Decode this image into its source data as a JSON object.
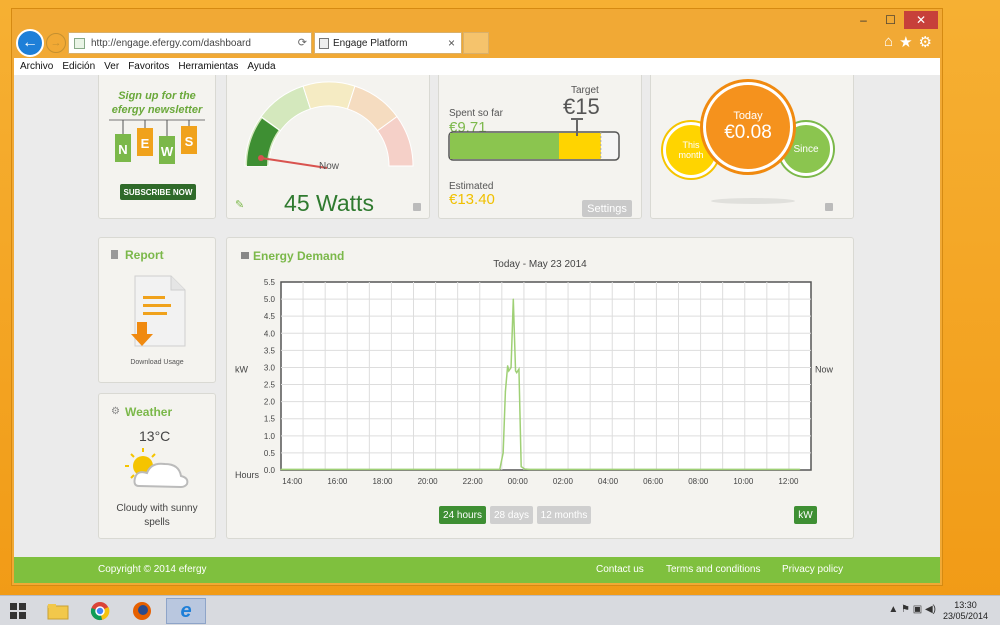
{
  "browser": {
    "url": "http://engage.efergy.com/dashboard",
    "url_host": "engage.efergy.com",
    "tab_title": "Engage Platform",
    "menu": [
      "Archivo",
      "Edición",
      "Ver",
      "Favoritos",
      "Herramientas",
      "Ayuda"
    ],
    "window_controls": {
      "minimize": "–",
      "maximize": "☐",
      "close": "✕"
    }
  },
  "newsletter": {
    "line1": "Sign up for the",
    "line2": "efergy newsletter",
    "tags": [
      "N",
      "E",
      "W",
      "S"
    ],
    "button": "SUBSCRIBE NOW"
  },
  "gauge": {
    "label": "Now",
    "value": "45 Watts",
    "level": 0.07
  },
  "budget": {
    "spent_label": "Spent so far",
    "spent_value": "€9.71",
    "target_label": "Target",
    "target_value": "€15",
    "estimated_label": "Estimated",
    "estimated_value": "€13.40",
    "settings": "Settings",
    "spent_fraction": 0.647,
    "estimated_fraction": 0.893
  },
  "costs": {
    "this_month": [
      "This",
      "month"
    ],
    "today_label": "Today",
    "today_value": "€0.08",
    "since": "Since"
  },
  "report": {
    "title": "Report",
    "link": "Download Usage"
  },
  "weather": {
    "title": "Weather",
    "temp": "13°C",
    "desc_line1": "Cloudy with sunny",
    "desc_line2": "spells"
  },
  "energy": {
    "title": "Energy Demand",
    "ranges": [
      "24 hours",
      "28 days",
      "12 months"
    ],
    "active_range": "24 hours",
    "unit_button": "kW"
  },
  "chart_data": {
    "type": "line",
    "title": "Today - May 23 2014",
    "xlabel": "Hours",
    "ylabel": "kW",
    "right_label": "Now",
    "ylim": [
      0,
      5.5
    ],
    "yticks": [
      "0.0",
      "0.5",
      "1.0",
      "1.5",
      "2.0",
      "2.5",
      "3.0",
      "3.5",
      "4.0",
      "4.5",
      "5.0",
      "5.5"
    ],
    "xticks": [
      "14:00",
      "16:00",
      "18:00",
      "20:00",
      "22:00",
      "00:00",
      "02:00",
      "04:00",
      "06:00",
      "08:00",
      "10:00",
      "12:00"
    ],
    "x_hours": [
      13.5,
      23.2,
      23.35,
      23.45,
      23.55,
      23.6,
      23.7,
      23.8,
      23.9,
      23.95,
      24.05,
      24.15,
      24.3,
      24.5,
      36.5
    ],
    "values": [
      0.02,
      0.02,
      0.5,
      2.3,
      3.05,
      2.9,
      3.0,
      5.0,
      2.9,
      2.85,
      2.95,
      0.1,
      0.03,
      0.02,
      0.02
    ],
    "grid": true,
    "color": "#9fd075"
  },
  "footer": {
    "copyright": "Copyright © 2014 efergy",
    "links": [
      "Contact us",
      "Terms and conditions",
      "Privacy policy"
    ]
  },
  "taskbar": {
    "time": "13:30",
    "date": "23/05/2014"
  }
}
